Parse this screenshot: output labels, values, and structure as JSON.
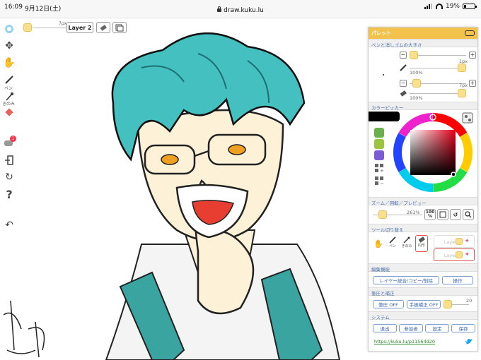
{
  "status_bar": {
    "time": "16:09",
    "date": "9月12日(土)",
    "url": "draw.kuku.lu",
    "battery": "19%"
  },
  "top_toolbar": {
    "pen_size": "7px",
    "layer_label": "Layer 2"
  },
  "left_toolbar": {
    "pen_label": "ペン",
    "smudge_label": "きのみ",
    "notification_count": "1"
  },
  "panel": {
    "title": "パレット",
    "sections": {
      "pen_eraser": "ペンと消しゴムの大きさ",
      "color_picker": "カラーピッカー",
      "zoom": "ズーム／回転／プレビュー",
      "tool_switch": "ツール切り替え",
      "edit": "編集機能",
      "pressure": "筆圧と補正",
      "system": "システム"
    },
    "pen_size": "1px",
    "pen_opacity": "100%",
    "eraser_size": "7px",
    "eraser_opacity": "100%",
    "zoom_value": "261%",
    "zoom_reset_label": "100",
    "zoom_reset_sub": "%",
    "tools": {
      "pen": "ペン",
      "smudge": "きのみ",
      "eraser": "円形"
    },
    "layers": [
      "Layer1",
      "Layer2"
    ],
    "edit_button": "レイヤー統合/コピー/削除",
    "operate_button": "操作",
    "pressure_button": "筆圧 OFF",
    "stabilizer_button": "手振補正 OFF",
    "stabilizer_value": "20",
    "system_buttons": [
      "退出",
      "参加者",
      "設定",
      "保存"
    ],
    "footer_link": "https://kuku.lu/p11564d20",
    "colors": {
      "green": "#6ab04c",
      "lime": "#9bc53d",
      "purple": "#7d5bd6",
      "black": "#000000"
    }
  }
}
